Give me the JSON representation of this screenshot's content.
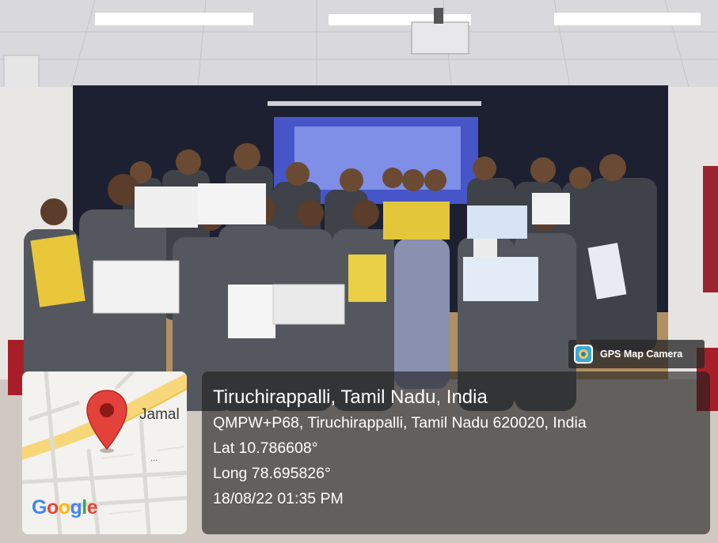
{
  "photo": {
    "description_name": "group-photo"
  },
  "overlay": {
    "badge": {
      "icon": "map-camera-app-icon",
      "label": "GPS Map Camera"
    },
    "map": {
      "place_label": "Jamal",
      "ellipsis": "...",
      "logo": {
        "letters": [
          "G",
          "o",
          "o",
          "g",
          "l",
          "e"
        ],
        "colors": [
          "#4285F4",
          "#EA4335",
          "#FBBC05",
          "#4285F4",
          "#34A853",
          "#EA4335"
        ]
      },
      "pin_color": "#E2423A"
    },
    "location": {
      "title": "Tiruchirappalli, Tamil Nadu, India",
      "address": "QMPW+P68, Tiruchirappalli, Tamil Nadu 620020, India",
      "latitude": "Lat 10.786608°",
      "longitude": "Long 78.695826°",
      "timestamp": "18/08/22 01:35 PM"
    }
  }
}
